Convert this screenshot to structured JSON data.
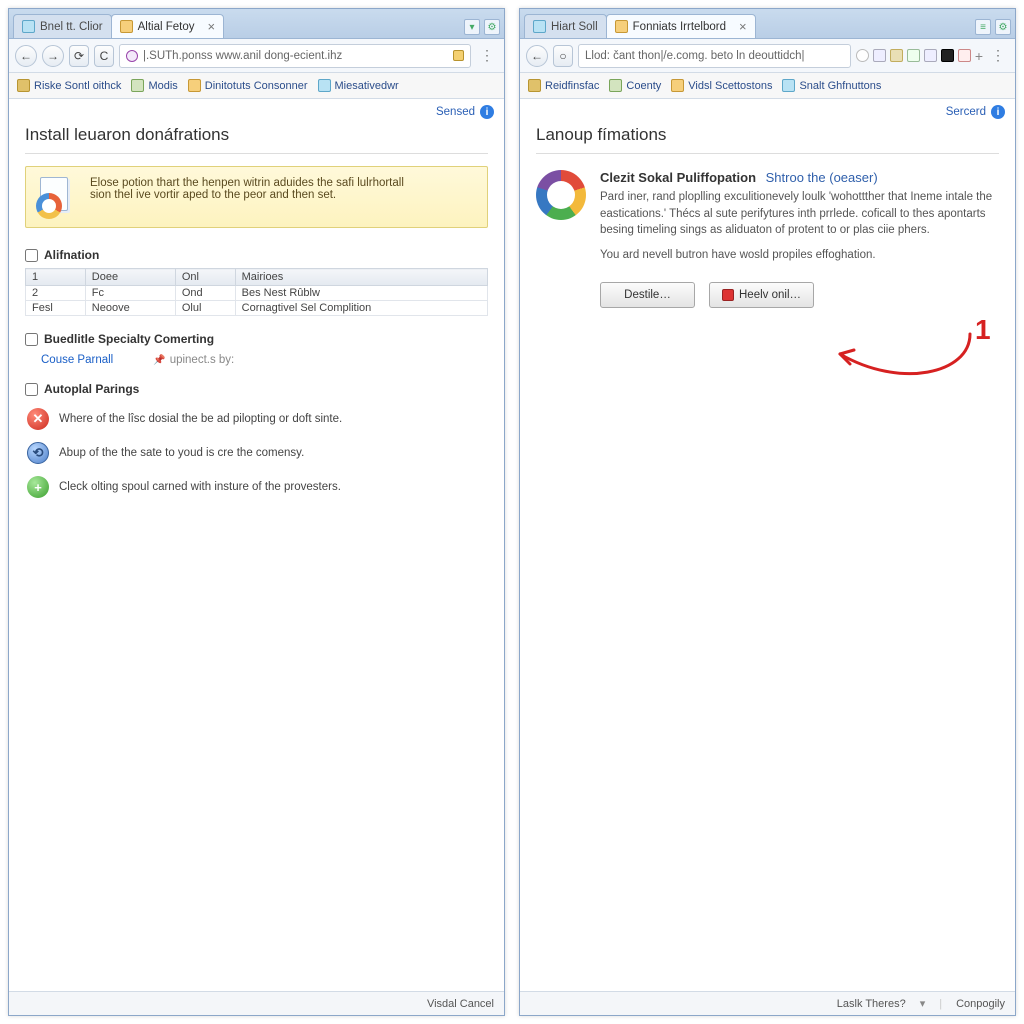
{
  "left": {
    "tabs": [
      {
        "label": "Bnel tt. Clior",
        "active": false
      },
      {
        "label": "Altial Fetoy",
        "active": true
      }
    ],
    "address": "|.SUTh.ponss www.anil dong-ecient.ihz",
    "bookmarks": [
      {
        "label": "Riske Sontl oithck",
        "key": "bm0"
      },
      {
        "label": "Modis",
        "key": "bm1"
      },
      {
        "label": "Dinitotuts Consonner",
        "key": "bm2"
      },
      {
        "label": "Miesativedwr",
        "key": "bm3"
      }
    ],
    "sensed_label": "Sensed",
    "page_title": "Install leuaron donáfrations",
    "notice_line1": "Elose potion thart the henpen witrin aduides the safi lulrhortall",
    "notice_line2": "sion thel ive vortir aped to the peor and then set.",
    "section_alifn": "Alifnation",
    "table": {
      "headers": [
        "1",
        "Doee",
        "Onl",
        "Mairioes"
      ],
      "rows": [
        [
          "2",
          "Fc",
          "Ond",
          "Bes Nest Rûblw"
        ],
        [
          "Fesl",
          "Neoove",
          "Olul",
          "Cornagtivel Sel Complition"
        ]
      ]
    },
    "section_spec": "Buedlitle Specialty Comerting",
    "link_course": "Couse Parnall",
    "link_upinect": "upinect.s by:",
    "section_autop": "Autoplal Parings",
    "status_red": "Where of the lîsc dosial the be ad pilopting or doft sinte.",
    "status_blue": "Abup of the the sate to youd is cre the comensy.",
    "status_green": "Cleck olting spoul carned with insture of the provesters.",
    "statusbar_text": "Visdal Cancel"
  },
  "right": {
    "tabs": [
      {
        "label": "Hiart Soll",
        "active": false
      },
      {
        "label": "Fonniats Irrtelbord",
        "active": true
      }
    ],
    "address": "Llod: čant thon|/e.comg. beto ln deouttidch|",
    "bookmarks": [
      {
        "label": "Reidfinsfac",
        "key": "bm0"
      },
      {
        "label": "Coenty",
        "key": "bm1"
      },
      {
        "label": "Vidsl Scettostons",
        "key": "bm2"
      },
      {
        "label": "Snalt Ghfnuttons",
        "key": "bm3"
      }
    ],
    "sensed_label": "Sercerd",
    "page_title": "Lanoup fímations",
    "hdr_bold": "Clezit Sokal Puliffopation",
    "hdr_link": "Shtroo the (oeaser)",
    "para1": "Pard iner, rand ploplling exculitionevely loulk 'wohottther that Ineme intale the eastications.' Thécs al sute perifytures inth prrlede. coficall to thes apontarts besing timeling sings as aliduaton of protent to or plas ciie phers.",
    "para2": "You ard nevell butron have wosld propiles effoghation.",
    "btn_destile": "Destile…",
    "btn_heelv": "Heelv onil…",
    "annot_number": "1",
    "statusbar_left": "Laslk Theres?",
    "statusbar_right": "Conpogily"
  }
}
